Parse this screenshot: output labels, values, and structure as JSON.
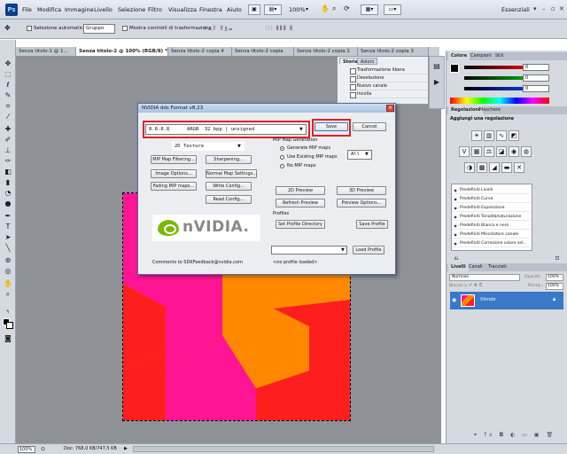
{
  "app": {
    "logo": "Ps"
  },
  "menubar": {
    "items": [
      "File",
      "Modifica",
      "Immagine",
      "Livello",
      "Selezione",
      "Filtro",
      "Visualizza",
      "Finestra",
      "Aiuto"
    ],
    "zoom_value": "100%",
    "workspace": "Essenziali"
  },
  "options_bar": {
    "auto_select_label": "Selezione automatica:",
    "auto_select_value": "Gruppo",
    "transform_controls_label": "Mostra controlli di trasformazione"
  },
  "doc_tabs": [
    "Senza titolo-1 @ 1...",
    "Senza titolo-2 @ 100% (RGB/8) *",
    "Senza titolo-2 copia 4",
    "Senza titolo-2 copia",
    "Senza titolo-2 copia 2",
    "Senza titolo-2 copia 3"
  ],
  "history_panel": {
    "tabs": [
      "Storia",
      "Azioni"
    ],
    "rows": [
      "Trasformazione libera",
      "Deselezione",
      "Nuovo canale",
      "Incolla"
    ]
  },
  "color_panel": {
    "tabs": [
      "Colore",
      "Campioni",
      "Stili"
    ],
    "values": [
      "0",
      "0",
      "0"
    ],
    "slider_colors": [
      "#ff0000",
      "#00c000",
      "#0040ff"
    ]
  },
  "adjustments_panel": {
    "tabs": [
      "Regolazioni",
      "Maschere"
    ],
    "title": "Aggiungi una regolazione",
    "presets": [
      "Predefiniti Livelli",
      "Predefiniti Curve",
      "Predefiniti Esposizione",
      "Predefiniti Tonalità/saturazione",
      "Predefiniti Bianco e nero",
      "Predefiniti Miscelatore canale",
      "Predefiniti Correzione colore sel..."
    ]
  },
  "layers_panel": {
    "tabs": [
      "Livelli",
      "Canali",
      "Tracciati"
    ],
    "blend_mode": "Normale",
    "opacity_label": "Opacità:",
    "opacity_value": "100%",
    "lock_label": "Blocca:",
    "fill_label": "Riemp.:",
    "fill_value": "100%",
    "layer_name": "Sfondo"
  },
  "statusbar": {
    "zoom": "100%",
    "doc_info": "Doc: 768,0 KB/747,5 KB"
  },
  "dialog": {
    "title": "NVIDIA dds Format v8.23",
    "format_value": "8.8.8.8      ARGB  32 bpp | unsigned",
    "save_label": "Save",
    "cancel_label": "Cancel",
    "texture_type": "2D Texture",
    "mip_filtering_label": "MIP Map Filtering...",
    "sharpening_label": "Sharpening...",
    "image_options_label": "Image Options...",
    "normal_map_label": "Normal Map Settings...",
    "fading_mip_label": "Fading MIP maps...",
    "write_config_label": "Write Config...",
    "read_config_label": "Read Config...",
    "mip_generation_label": "MIP Map Generation",
    "generate_mip_label": "Generate MIP maps",
    "use_existing_mip_label": "Use Existing MIP maps",
    "no_mip_label": "No MIP maps",
    "mip_count": "All",
    "preview_2d_label": "2D Preview",
    "preview_3d_label": "3D Preview",
    "refresh_preview_label": "Refresh Preview",
    "preview_options_label": "Preview Options...",
    "profiles_label": "Profiles",
    "set_profile_dir_label": "Set Profile Directory",
    "save_profile_label": "Save Profile",
    "load_profile_label": "Load Profile",
    "logo_text": "nVIDIA.",
    "feedback_text": "Comments to SDKFeedback@nvidia.com",
    "profile_status": "<no profile loaded>"
  },
  "canvas": {
    "colors": {
      "pink": "#ff1493",
      "orange": "#ff8800",
      "red": "#ff1e1e"
    }
  }
}
